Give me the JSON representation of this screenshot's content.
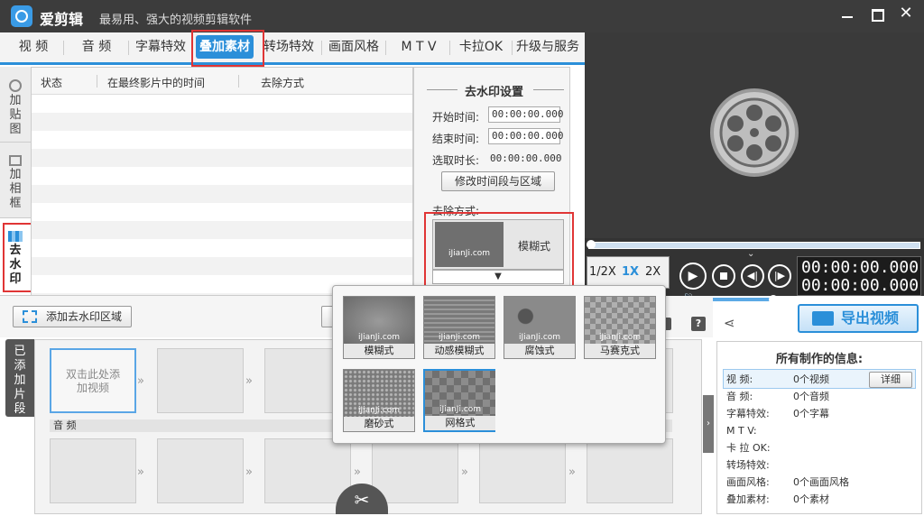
{
  "app": {
    "title": "爱剪辑",
    "subtitle": "最易用、强大的视频剪辑软件"
  },
  "tabs": [
    "视 频",
    "音 频",
    "字幕特效",
    "叠加素材",
    "转场特效",
    "画面风格",
    "M T V",
    "卡拉OK",
    "升级与服务"
  ],
  "side_tabs": [
    {
      "label": "加贴图"
    },
    {
      "label": "加相框"
    },
    {
      "label": "去水印"
    }
  ],
  "list": {
    "col_status": "状态",
    "col_time": "在最终影片中的时间",
    "col_method": "去除方式"
  },
  "watermark": {
    "title": "去水印设置",
    "start_label": "开始时间:",
    "start_value": "00:00:00.000",
    "end_label": "结束时间:",
    "end_value": "00:00:00.000",
    "duration_label": "选取时长:",
    "duration_value": "00:00:00.000",
    "modify_button": "修改时间段与区域",
    "method_label": "去除方式:",
    "selected_method": "模糊式",
    "site": "iJianJi.com"
  },
  "add_region_button": "添加去水印区域",
  "clips": {
    "label": "已添加片段",
    "placeholder": "双击此处添加视频",
    "audio_label": "音 频"
  },
  "popup": {
    "site": "iJianJi.com",
    "options": [
      "模糊式",
      "动感模糊式",
      "腐蚀式",
      "马赛克式",
      "磨砂式",
      "网格式"
    ]
  },
  "player": {
    "speeds": [
      "1/2X",
      "1X",
      "2X"
    ],
    "time_current": "00:00:00.000",
    "time_total": "00:00:00.000",
    "volume": 0.75,
    "progress": 0
  },
  "export_button": "导出视频",
  "info": {
    "title": "所有制作的信息:",
    "detail_button": "详细",
    "rows": [
      {
        "label": "视   频:",
        "value": "0个视频"
      },
      {
        "label": "音   频:",
        "value": "0个音频"
      },
      {
        "label": "字幕特效:",
        "value": "0个字幕"
      },
      {
        "label": "M  T  V:",
        "value": ""
      },
      {
        "label": "卡 拉 OK:",
        "value": ""
      },
      {
        "label": "转场特效:",
        "value": ""
      },
      {
        "label": "画面风格:",
        "value": "0个画面风格"
      },
      {
        "label": "叠加素材:",
        "value": "0个素材"
      }
    ]
  },
  "colors": {
    "accent": "#2b8fd9",
    "titlebar": "#3c3c3c",
    "highlight": "#e03535"
  }
}
